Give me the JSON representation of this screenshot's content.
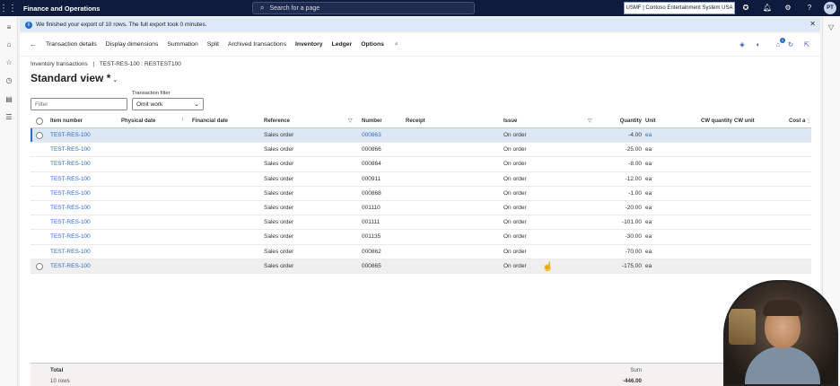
{
  "app": {
    "title": "Finance and Operations",
    "search_placeholder": "Search for a page",
    "company": "USMF | Contoso Entertainment System USA",
    "user_initials": "PT"
  },
  "message": {
    "text": "We finished your export of 10 rows. The full export took 0 minutes."
  },
  "action_pane": {
    "items": [
      {
        "label": "Transaction details"
      },
      {
        "label": "Display dimensions"
      },
      {
        "label": "Summation"
      },
      {
        "label": "Split"
      },
      {
        "label": "Archived transactions"
      },
      {
        "label": "Inventory"
      },
      {
        "label": "Ledger"
      },
      {
        "label": "Options"
      }
    ],
    "badge_count": "1"
  },
  "breadcrumb": {
    "parent": "Inventory transactions",
    "separator": "|",
    "current": "TEST-RES-100 : RESTEST100"
  },
  "view": {
    "title": "Standard view *"
  },
  "filters": {
    "filter_placeholder": "Filter",
    "transaction_filter_label": "Transaction filter",
    "transaction_filter_value": "Omit work"
  },
  "grid": {
    "columns": {
      "item_number": "Item number",
      "physical_date": "Physical date",
      "financial_date": "Financial date",
      "reference": "Reference",
      "number": "Number",
      "receipt": "Receipt",
      "issue": "Issue",
      "quantity": "Quantity",
      "unit": "Unit",
      "cw_quantity": "CW quantity",
      "cw_unit": "CW unit",
      "cost_amount": "Cost a"
    },
    "rows": [
      {
        "item": "TEST-RES-100",
        "reference": "Sales order",
        "number": "000863",
        "issue": "On order",
        "quantity": "-4.00",
        "unit": "ea"
      },
      {
        "item": "TEST-RES-100",
        "reference": "Sales order",
        "number": "000866",
        "issue": "On order",
        "quantity": "-25.00",
        "unit": "ea"
      },
      {
        "item": "TEST-RES-100",
        "reference": "Sales order",
        "number": "000864",
        "issue": "On order",
        "quantity": "-8.00",
        "unit": "ea"
      },
      {
        "item": "TEST-RES-100",
        "reference": "Sales order",
        "number": "000911",
        "issue": "On order",
        "quantity": "-12.00",
        "unit": "ea"
      },
      {
        "item": "TEST-RES-100",
        "reference": "Sales order",
        "number": "000868",
        "issue": "On order",
        "quantity": "-1.00",
        "unit": "ea"
      },
      {
        "item": "TEST-RES-100",
        "reference": "Sales order",
        "number": "001110",
        "issue": "On order",
        "quantity": "-20.00",
        "unit": "ea"
      },
      {
        "item": "TEST-RES-100",
        "reference": "Sales order",
        "number": "001111",
        "issue": "On order",
        "quantity": "-101.00",
        "unit": "ea"
      },
      {
        "item": "TEST-RES-100",
        "reference": "Sales order",
        "number": "001135",
        "issue": "On order",
        "quantity": "-30.00",
        "unit": "ea"
      },
      {
        "item": "TEST-RES-100",
        "reference": "Sales order",
        "number": "000862",
        "issue": "On order",
        "quantity": "-70.00",
        "unit": "ea"
      },
      {
        "item": "TEST-RES-100",
        "reference": "Sales order",
        "number": "000865",
        "issue": "On order",
        "quantity": "-175.00",
        "unit": "ea"
      }
    ],
    "footer": {
      "total_label": "Total",
      "rows_label": "10 rows",
      "sum_label": "Sum",
      "sum_value": "-446.00"
    }
  },
  "colors": {
    "topbar": "#0f1b3d",
    "accent": "#2b6cc4",
    "selected_row": "#dde8f6",
    "message_bar": "#dce9f8"
  }
}
